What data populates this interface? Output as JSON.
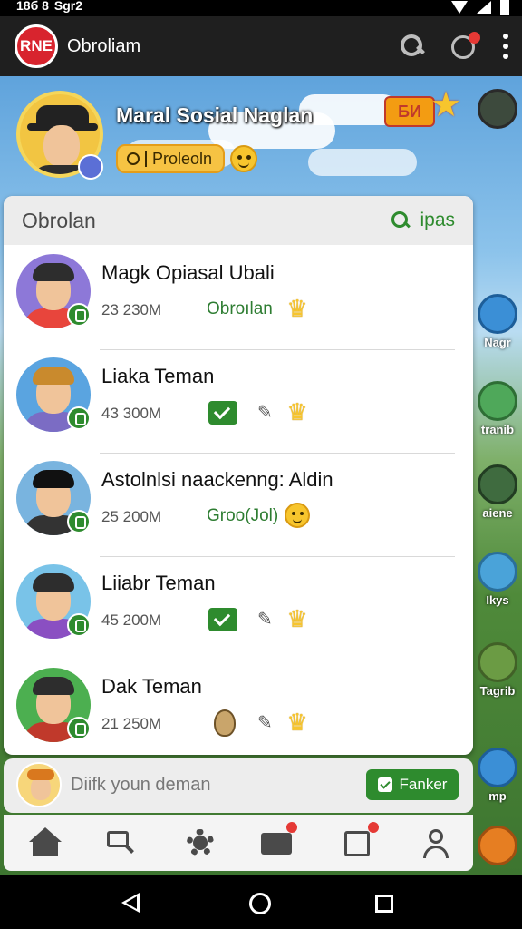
{
  "status_bar": {
    "time": "18б 8",
    "carrier": "Sgr2"
  },
  "app_bar": {
    "logo_text": "RNE",
    "title": "Obroliam"
  },
  "profile": {
    "name": "Maral Sosial Naglan",
    "chip_label": "Proleoln",
    "badge_text": "БИ"
  },
  "panel": {
    "title": "Obrolan",
    "search_label": "ipas"
  },
  "chats": [
    {
      "name": "Magk Opiasal Ubali",
      "meta": "23 230M",
      "status": "Obroılan",
      "shirt": "#e8453c",
      "bg": "#8d78d8"
    },
    {
      "name": "Liaka Teman",
      "meta": "43 300M",
      "status": "",
      "shirt": "#7b6cc4",
      "bg": "#5aa4e0"
    },
    {
      "name": "Astolnlsi naackenng: Aldin",
      "meta": "25 200M",
      "status": "Groo(Jol)",
      "shirt": "#333333",
      "bg": "#79b4df"
    },
    {
      "name": "Liiabr Teman",
      "meta": "45 200M",
      "status": "",
      "shirt": "#8a4fc2",
      "bg": "#79c3e8"
    },
    {
      "name": "Dak Teman",
      "meta": "21 250M",
      "status": "",
      "shirt": "#c0392b",
      "bg": "#4caf50"
    }
  ],
  "input_bar": {
    "placeholder": "Diifk youn deman",
    "send_label": "Fanker"
  },
  "game_sidebar": [
    {
      "label": ""
    },
    {
      "label": "Nagr"
    },
    {
      "label": "tranib"
    },
    {
      "label": "aiene"
    },
    {
      "label": "Ikys"
    },
    {
      "label": "Tagrib"
    },
    {
      "label": "mp"
    }
  ],
  "bottom_nav": [
    "home-icon",
    "chat-search-icon",
    "gear-icon",
    "mail-icon",
    "task-icon",
    "profile-icon"
  ],
  "colors": {
    "accent": "#2e8b2e",
    "app_bar": "#1f1f1f",
    "brand_red": "#d8242e"
  }
}
